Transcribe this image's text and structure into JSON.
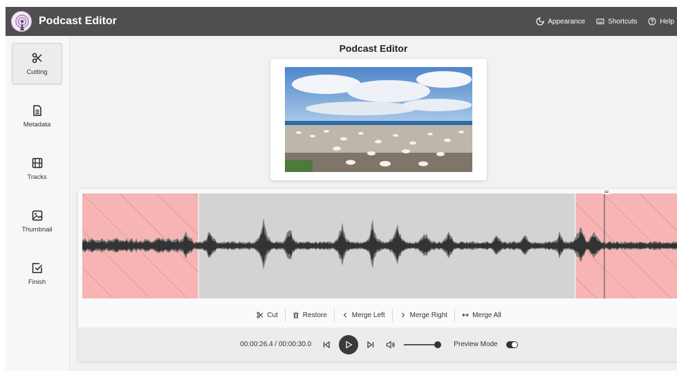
{
  "app": {
    "title": "Podcast Editor"
  },
  "topnav": {
    "appearance": "Appearance",
    "shortcuts": "Shortcuts",
    "help": "Help"
  },
  "sidebar": {
    "items": [
      {
        "label": "Cutting",
        "icon": "scissors-icon",
        "active": true
      },
      {
        "label": "Metadata",
        "icon": "document-icon"
      },
      {
        "label": "Tracks",
        "icon": "film-icon"
      },
      {
        "label": "Thumbnail",
        "icon": "image-icon"
      },
      {
        "label": "Finish",
        "icon": "checkbox-icon"
      }
    ]
  },
  "main": {
    "title": "Podcast Editor"
  },
  "toolbar": {
    "cut": "Cut",
    "restore": "Restore",
    "merge_left": "Merge Left",
    "merge_right": "Merge Right",
    "merge_all": "Merge All"
  },
  "player": {
    "time": "00:00:26.4 / 00:00:30.0",
    "volume": 1.0,
    "preview_label": "Preview Mode",
    "preview_on": true
  },
  "colors": {
    "topbar": "#4f4f4f",
    "cut_region": "#f7b4b4",
    "waveform": "#3b3b3b",
    "kept_region": "#d3d3d3"
  }
}
